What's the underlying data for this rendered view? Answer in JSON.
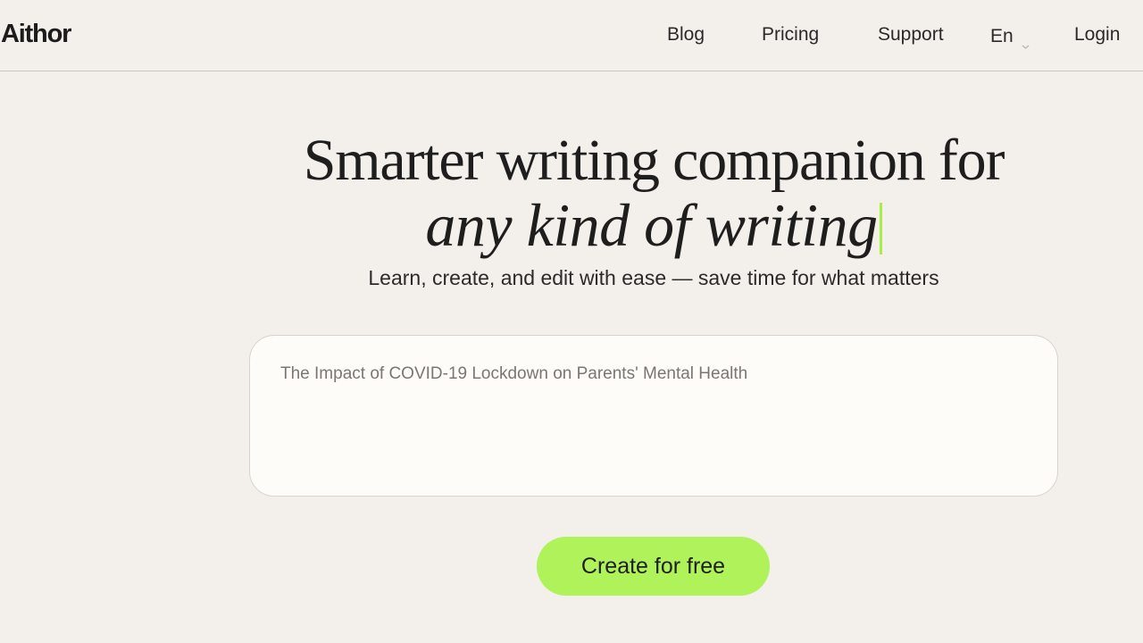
{
  "header": {
    "logo": "Aithor",
    "nav": {
      "blog": "Blog",
      "pricing": "Pricing",
      "support": "Support",
      "language": "En",
      "login": "Login"
    }
  },
  "hero": {
    "title_line1": "Smarter writing companion for",
    "title_line2": "any kind of writing",
    "subtitle": "Learn, create, and edit with ease — save time for what matters"
  },
  "prompt_input": {
    "placeholder": "The Impact of COVID-19 Lockdown on Parents' Mental Health",
    "value": ""
  },
  "cta": {
    "label": "Create for free"
  },
  "colors": {
    "background": "#f3efea",
    "accent": "#b0f25a",
    "input_background": "#fdfcf9"
  },
  "icons": {
    "language_dropdown": "chevron-down-icon"
  }
}
